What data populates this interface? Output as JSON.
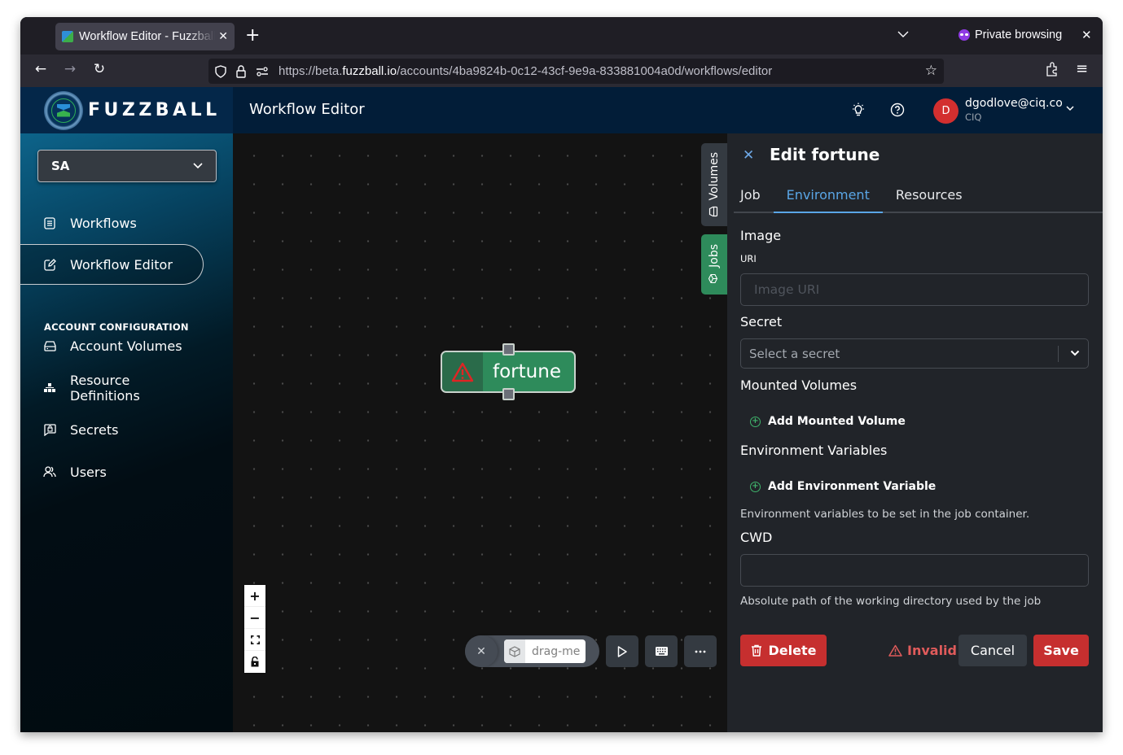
{
  "browser": {
    "tab_title": "Workflow Editor - Fuzzball",
    "private_label": "Private browsing",
    "url_prefix": "https://beta.",
    "url_domain": "fuzzball.io",
    "url_path": "/accounts/4ba9824b-0c12-43cf-9e9a-833881004a0d/workflows/editor"
  },
  "brand": {
    "name": "FUZZBALL"
  },
  "sidebar": {
    "account_selector": "SA",
    "items": [
      {
        "label": "Workflows",
        "icon": "list-icon"
      },
      {
        "label": "Workflow Editor",
        "icon": "edit-icon",
        "active": true
      }
    ],
    "section_heading": "ACCOUNT CONFIGURATION",
    "config_items": [
      {
        "label": "Account Volumes",
        "icon": "drive-icon"
      },
      {
        "label": "Resource Definitions",
        "icon": "hierarchy-icon"
      },
      {
        "label": "Secrets",
        "icon": "secret-icon"
      },
      {
        "label": "Users",
        "icon": "users-icon"
      }
    ]
  },
  "header": {
    "title": "Workflow Editor",
    "user_initial": "D",
    "user_email": "dgodlove@ciq.co",
    "user_org": "CIQ"
  },
  "canvas": {
    "side_tabs": {
      "volumes": "Volumes",
      "jobs": "Jobs"
    },
    "node": {
      "label": "fortune",
      "status": "warning"
    },
    "drag_chip": "drag-me"
  },
  "panel": {
    "title": "Edit fortune",
    "tabs": [
      "Job",
      "Environment",
      "Resources"
    ],
    "active_tab": "Environment",
    "image_heading": "Image",
    "uri_label": "URI",
    "uri_placeholder": "Image URI",
    "uri_value": "",
    "secret_label": "Secret",
    "secret_placeholder": "Select a secret",
    "mounted_volumes_heading": "Mounted Volumes",
    "add_mounted_volume": "Add Mounted Volume",
    "env_vars_heading": "Environment Variables",
    "add_env_var": "Add Environment Variable",
    "env_vars_help": "Environment variables to be set in the job container.",
    "cwd_label": "CWD",
    "cwd_value": "",
    "cwd_help": "Absolute path of the working directory used by the job",
    "delete_label": "Delete",
    "status_label": "Invalid",
    "cancel_label": "Cancel",
    "save_label": "Save"
  },
  "colors": {
    "accent_blue": "#5aa6e6",
    "node_green": "#2e8b5b",
    "danger_red": "#c62f2f",
    "invalid_text": "#e05b5b"
  }
}
